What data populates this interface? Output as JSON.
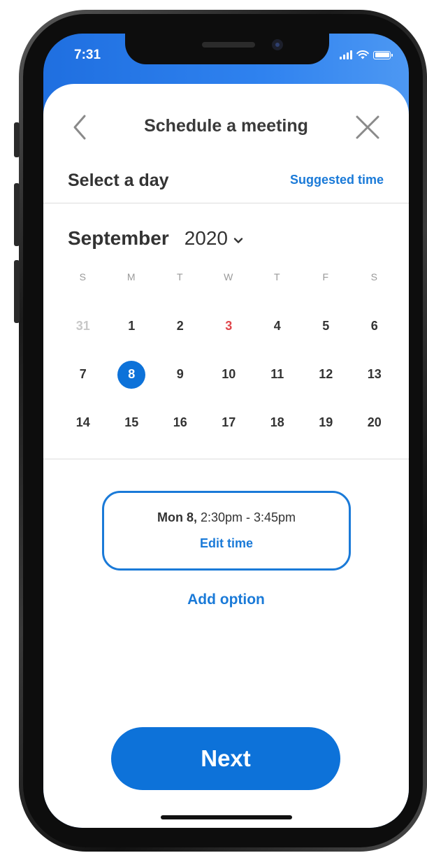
{
  "status_bar": {
    "time": "7:31"
  },
  "header": {
    "title": "Schedule a meeting"
  },
  "day_picker": {
    "label": "Select a day",
    "suggested_link": "Suggested time",
    "month": "September",
    "year": "2020",
    "weekdays": [
      "S",
      "M",
      "T",
      "W",
      "T",
      "F",
      "S"
    ],
    "weeks": [
      [
        {
          "d": "31",
          "state": "muted"
        },
        {
          "d": "1"
        },
        {
          "d": "2"
        },
        {
          "d": "3",
          "state": "today"
        },
        {
          "d": "4"
        },
        {
          "d": "5"
        },
        {
          "d": "6"
        }
      ],
      [
        {
          "d": "7"
        },
        {
          "d": "8",
          "state": "selected"
        },
        {
          "d": "9"
        },
        {
          "d": "10"
        },
        {
          "d": "11"
        },
        {
          "d": "12"
        },
        {
          "d": "13"
        }
      ],
      [
        {
          "d": "14"
        },
        {
          "d": "15"
        },
        {
          "d": "16"
        },
        {
          "d": "17"
        },
        {
          "d": "18"
        },
        {
          "d": "19"
        },
        {
          "d": "20"
        }
      ]
    ]
  },
  "time_option": {
    "day": "Mon 8,",
    "range": "2:30pm - 3:45pm",
    "edit_label": "Edit time"
  },
  "add_option_label": "Add option",
  "next_label": "Next",
  "colors": {
    "accent": "#1a7ad8",
    "selected_day": "#0d72d9",
    "today": "#e0474c",
    "header_gradient_start": "#1f6fe0",
    "header_gradient_end": "#4d98f3"
  }
}
